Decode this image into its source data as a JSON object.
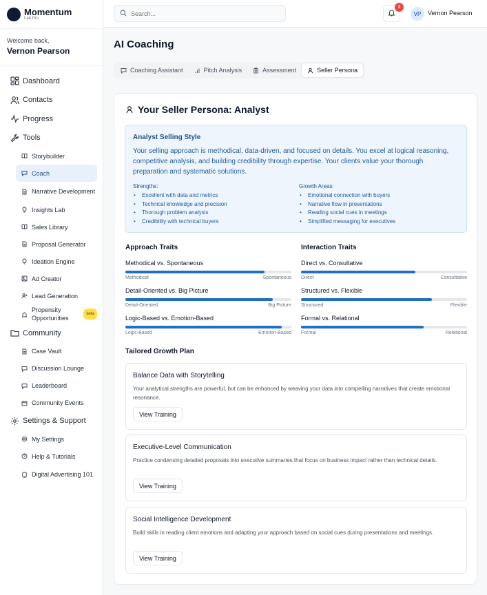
{
  "brand": {
    "name": "Momentum",
    "sub": "Lab Pro"
  },
  "welcome": {
    "label": "Welcome back,",
    "name": "Vernon Pearson"
  },
  "nav": {
    "dashboard": "Dashboard",
    "contacts": "Contacts",
    "progress": "Progress",
    "tools": "Tools",
    "tools_items": [
      "Storybuilder",
      "Coach",
      "Narrative Development",
      "Insights Lab",
      "Sales Library",
      "Proposal Generator",
      "Ideation Engine",
      "Ad Creator",
      "Lead Generation",
      "Propensity Opportunities"
    ],
    "beta": "beta",
    "community": "Community",
    "community_items": [
      "Case Vault",
      "Discussion Lounge",
      "Leaderboard",
      "Community Events"
    ],
    "settings": "Settings & Support",
    "settings_items": [
      "My Settings",
      "Help & Tutorials",
      "Digital Advertising 101"
    ]
  },
  "header": {
    "search_placeholder": "Search...",
    "notifications": "3",
    "avatar_initials": "VP",
    "user_name": "Vernon Pearson"
  },
  "page": {
    "title": "AI Coaching"
  },
  "tabs": [
    "Coaching Assistant",
    "Pitch Analysis",
    "Assessment",
    "Seller Persona"
  ],
  "persona": {
    "title": "Your Seller Persona: Analyst",
    "style_title": "Analyst Selling Style",
    "style_desc": "Your selling approach is methodical, data-driven, and focused on details. You excel at logical reasoning, competitive analysis, and building credibility through expertise. Your clients value your thorough preparation and systematic solutions.",
    "strengths_label": "Strengths:",
    "strengths": [
      "Excellent with data and metrics",
      "Technical knowledge and precision",
      "Thorough problem analysis",
      "Credibility with technical buyers"
    ],
    "growth_label": "Growth Areas:",
    "growth": [
      "Emotional connection with buyers",
      "Narrative flow in presentations",
      "Reading social cues in meetings",
      "Simplified messaging for executives"
    ]
  },
  "approach_traits": {
    "title": "Approach Traits",
    "items": [
      {
        "name": "Methodical vs. Spontaneous",
        "left": "Methodical",
        "right": "Spontaneous",
        "value": 0.84
      },
      {
        "name": "Detail-Oriented vs. Big Picture",
        "left": "Detail-Oriented",
        "right": "Big Picture",
        "value": 0.89
      },
      {
        "name": "Logic-Based vs. Emotion-Based",
        "left": "Logic-Based",
        "right": "Emotion-Based",
        "value": 0.94
      }
    ]
  },
  "interaction_traits": {
    "title": "Interaction Traits",
    "items": [
      {
        "name": "Direct vs. Consultative",
        "left": "Direct",
        "right": "Consultative",
        "value": 0.69
      },
      {
        "name": "Structured vs. Flexible",
        "left": "Structured",
        "right": "Flexible",
        "value": 0.79
      },
      {
        "name": "Formal vs. Relational",
        "left": "Formal",
        "right": "Relational",
        "value": 0.74
      }
    ]
  },
  "growth_plan": {
    "title": "Tailored Growth Plan",
    "button": "View Training",
    "items": [
      {
        "title": "Balance Data with Storytelling",
        "desc": "Your analytical strengths are powerful, but can be enhanced by weaving your data into compelling narratives that create emotional resonance."
      },
      {
        "title": "Executive-Level Communication",
        "desc": "Practice condensing detailed proposals into executive summaries that focus on business impact rather than technical details."
      },
      {
        "title": "Social Intelligence Development",
        "desc": "Build skills in reading client emotions and adapting your approach based on social cues during presentations and meetings."
      }
    ]
  }
}
